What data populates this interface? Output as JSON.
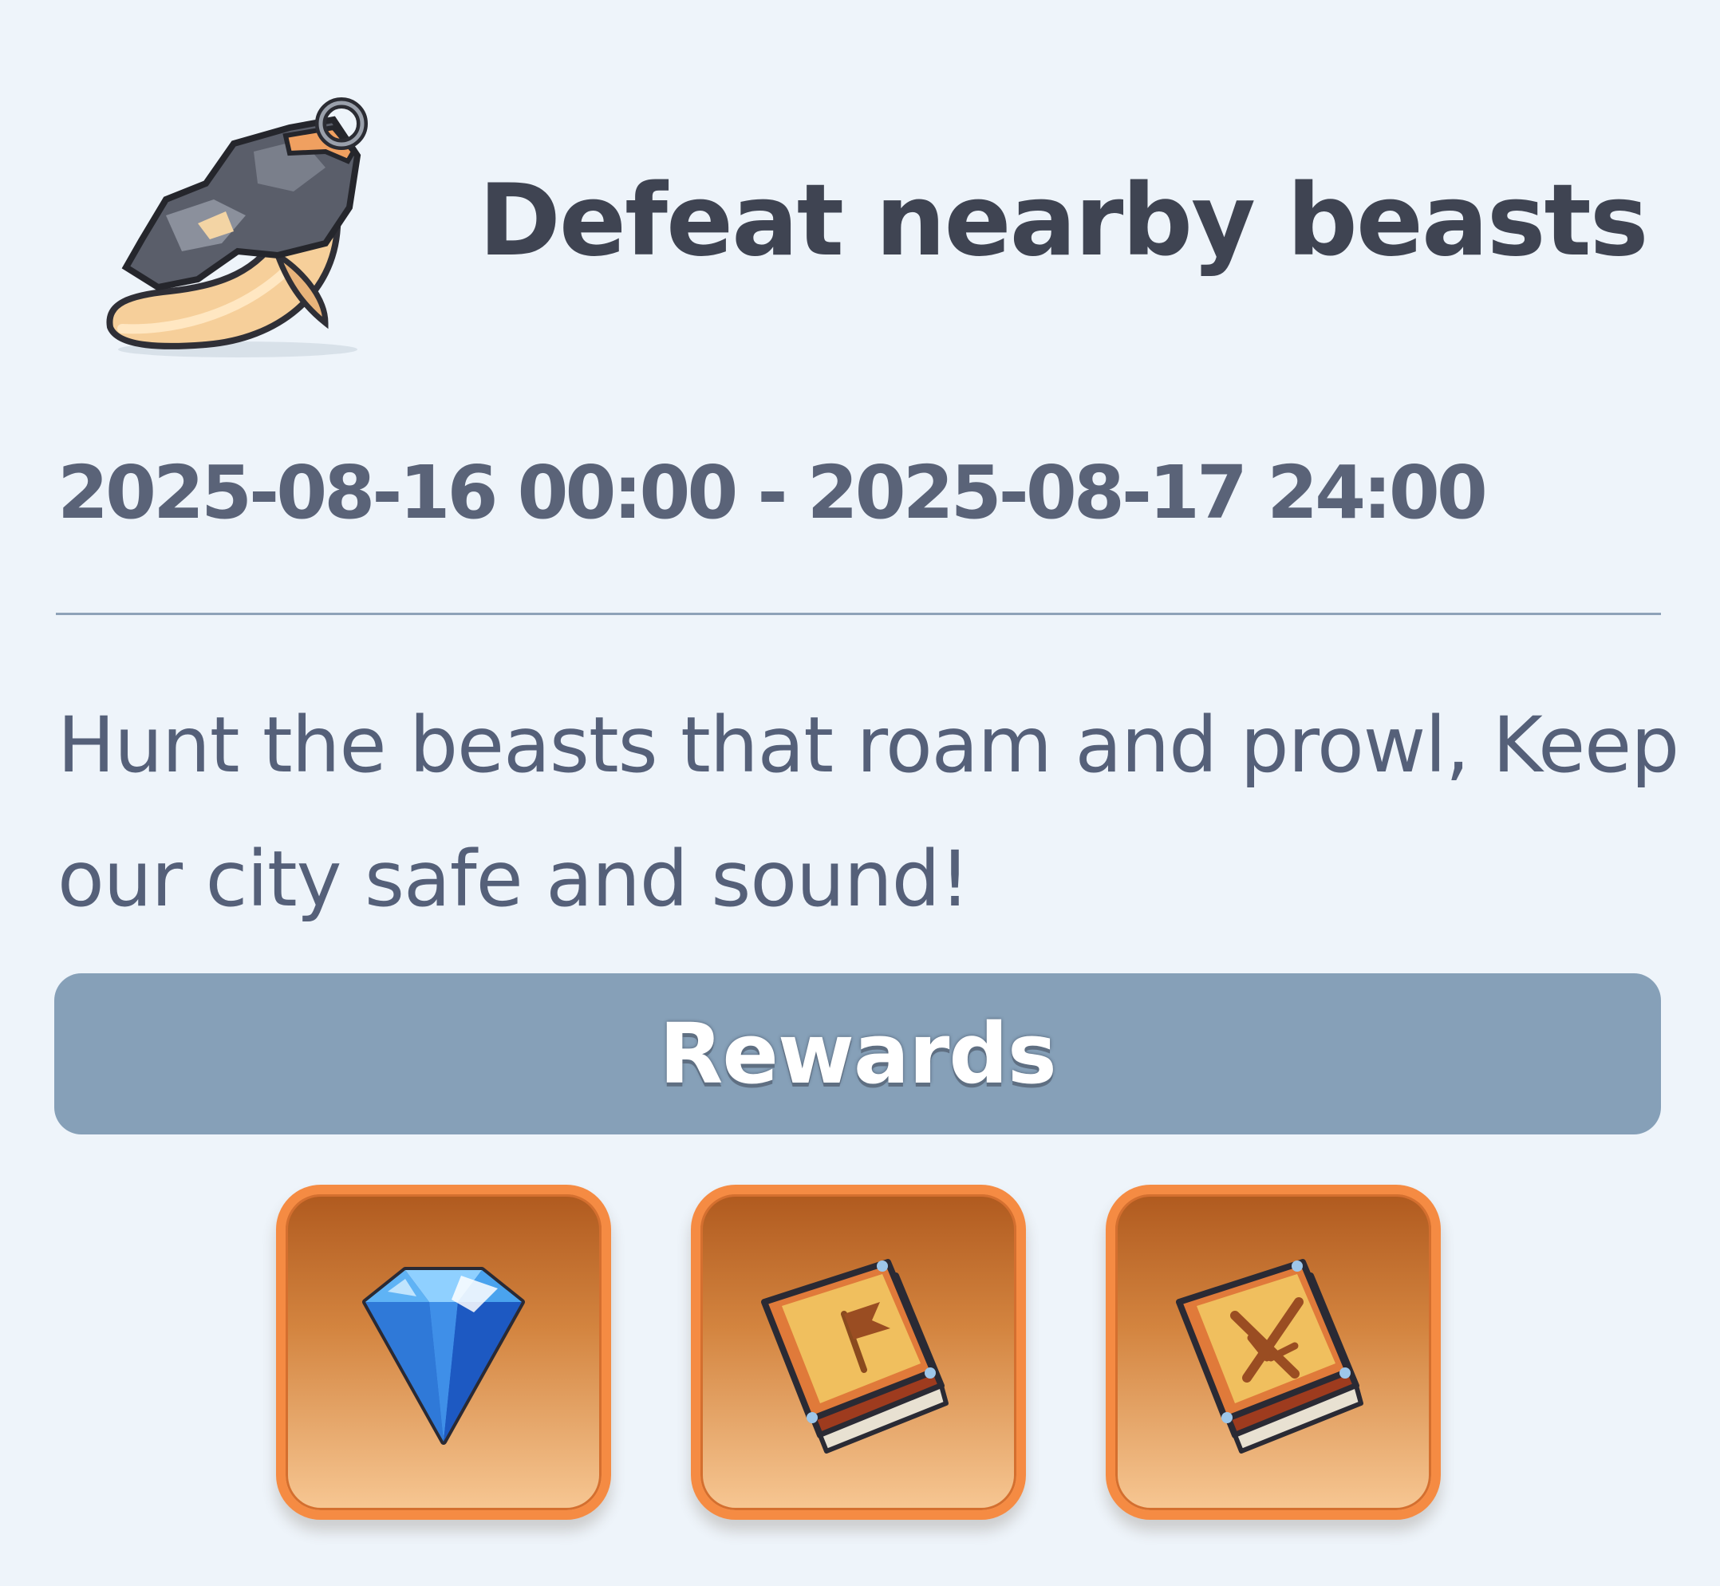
{
  "quest": {
    "title": "Defeat nearby beasts",
    "date_range": "2025-08-16 00:00 - 2025-08-17 24:00",
    "description": "Hunt the beasts that roam and prowl, Keep our city safe and sound!",
    "icon": "beast-fang-icon"
  },
  "rewards": {
    "title": "Rewards",
    "items": [
      {
        "icon": "diamond-icon"
      },
      {
        "icon": "rally-book-icon"
      },
      {
        "icon": "combat-book-icon"
      }
    ]
  },
  "colors": {
    "background": "#eef4fa",
    "title_text": "#3f4452",
    "body_text": "#556079",
    "rewards_bar": "#86a0b8",
    "slot_border": "#f58b43"
  }
}
